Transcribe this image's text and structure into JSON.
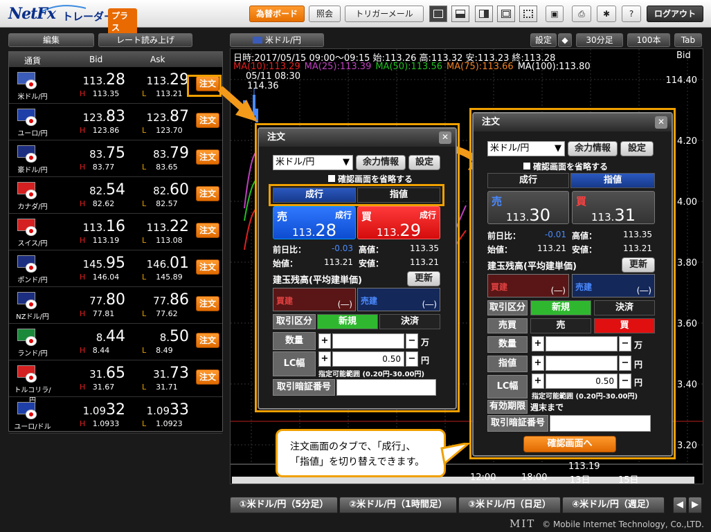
{
  "header": {
    "brand": "NetFx",
    "brand_sub": "トレーダー・",
    "plus": "プラス",
    "buttons": [
      "為替ボード",
      "照会",
      "トリガーメール"
    ],
    "logout": "ログアウト"
  },
  "left": {
    "edit": "編集",
    "readout": "レート読み上げ",
    "cols": {
      "cur": "通貨",
      "bid": "Bid",
      "ask": "Ask"
    },
    "order_label": "注文",
    "rates": [
      {
        "name": "米ドル/円",
        "bid_a": "113.",
        "bid_b": "28",
        "ask_a": "113.",
        "ask_b": "29",
        "high": "113.35",
        "low": "113.21",
        "order": true,
        "flag": "#3b5bb8"
      },
      {
        "name": "ユーロ/円",
        "bid_a": "123.",
        "bid_b": "83",
        "ask_a": "123.",
        "ask_b": "87",
        "high": "123.86",
        "low": "123.70",
        "order": true,
        "flag": "#1f3fa8"
      },
      {
        "name": "豪ドル/円",
        "bid_a": "83.",
        "bid_b": "75",
        "ask_a": "83.",
        "ask_b": "79",
        "high": "83.77",
        "low": "83.65",
        "order": true,
        "flag": "#1c2e80"
      },
      {
        "name": "カナダ/円",
        "bid_a": "82.",
        "bid_b": "54",
        "ask_a": "82.",
        "ask_b": "60",
        "high": "82.62",
        "low": "82.57",
        "order": true,
        "flag": "#d42020"
      },
      {
        "name": "スイス/円",
        "bid_a": "113.",
        "bid_b": "16",
        "ask_a": "113.",
        "ask_b": "22",
        "high": "113.19",
        "low": "113.08",
        "order": true,
        "flag": "#d42020"
      },
      {
        "name": "ポンド/円",
        "bid_a": "145.",
        "bid_b": "95",
        "ask_a": "146.",
        "ask_b": "01",
        "high": "146.04",
        "low": "145.89",
        "order": true,
        "flag": "#1c2e80"
      },
      {
        "name": "NZドル/円",
        "bid_a": "77.",
        "bid_b": "80",
        "ask_a": "77.",
        "ask_b": "86",
        "high": "77.81",
        "low": "77.62",
        "order": true,
        "flag": "#1c2e80"
      },
      {
        "name": "ランド/円",
        "bid_a": "8.",
        "bid_b": "44",
        "ask_a": "8.",
        "ask_b": "50",
        "high": "8.44",
        "low": "8.49",
        "order": true,
        "flag": "#1a8a3a"
      },
      {
        "name": "トルコリラ/円",
        "bid_a": "31.",
        "bid_b": "65",
        "ask_a": "31.",
        "ask_b": "73",
        "high": "31.67",
        "low": "31.71",
        "order": true,
        "flag": "#d42020"
      },
      {
        "name": "ユーロ/ドル",
        "bid_a": "1.09",
        "bid_b": "32",
        "ask_a": "1.09",
        "ask_b": "33",
        "high": "1.0933",
        "low": "1.0923",
        "order": false,
        "flag": "#1f3fa8"
      }
    ]
  },
  "chart": {
    "pair_tab": "米ドル/円",
    "settings": "設定",
    "period": "30分足",
    "count": "100本",
    "tab": "Tab",
    "ohlc": "日時:2017/05/15 09:00～09:15 始:113.26 高:113.32 安:113.23 終:113.28",
    "side": "Bid",
    "ma": [
      {
        "label": "MA(10):113.29",
        "color": "#e02020"
      },
      {
        "label": "MA(25):113.39",
        "color": "#c040c0"
      },
      {
        "label": "MA(50):113.56",
        "color": "#20c020"
      },
      {
        "label": "MA(75):113.66",
        "color": "#f08020"
      },
      {
        "label": "MA(100):113.80",
        "color": "#ffffff"
      }
    ],
    "peak_date": "05/11 08:30",
    "peak_val": "114.36",
    "y_ticks": [
      "114.40",
      "4.20",
      "4.00",
      "3.80",
      "3.60",
      "3.40",
      "3.20"
    ],
    "low_label": "113.19",
    "x_ticks": [
      "12:00",
      "18:00",
      "13日",
      "15日"
    ]
  },
  "bottom_tabs": [
    "①米ドル/円（5分足）",
    "②米ドル/円（1時間足）",
    "③米ドル/円（日足）",
    "④米ドル/円（週足）"
  ],
  "footer": "© Mobile Internet Technology, Co.,LTD.",
  "footer_logo": "MIT",
  "dialog_left": {
    "title": "注文",
    "pair": "米ドル/円",
    "margin_info": "余力情報",
    "settings": "設定",
    "skip_confirm": "確認画面を省略する",
    "tab_market": "成行",
    "tab_limit": "指値",
    "sell": "売",
    "buy": "買",
    "type": "成行",
    "sell_a": "113.",
    "sell_b": "28",
    "buy_a": "113.",
    "buy_b": "29",
    "prev": "前日比：",
    "prev_v": "-0.03",
    "high": "高値：",
    "high_v": "113.35",
    "open": "始値：",
    "open_v": "113.21",
    "low": "安値：",
    "low_v": "113.21",
    "position": "建玉残高(平均建単価)",
    "refresh": "更新",
    "pos_sell": "買建",
    "pos_buy": "売建",
    "dash": "(―)",
    "kind": "取引区分",
    "new": "新規",
    "settle": "決済",
    "qty": "数量",
    "unit_man": "万",
    "lc": "LC幅",
    "lc_v": "0.50",
    "unit_yen": "円",
    "range": "指定可能範囲 (0.20円-30.00円)",
    "pin": "取引暗証番号"
  },
  "dialog_right": {
    "title": "注文",
    "pair": "米ドル/円",
    "margin_info": "余力情報",
    "settings": "設定",
    "skip_confirm": "確認画面を省略する",
    "tab_market": "成行",
    "tab_limit": "指値",
    "sell": "売",
    "buy": "買",
    "sell_a": "113.",
    "sell_b": "30",
    "buy_a": "113.",
    "buy_b": "31",
    "prev": "前日比：",
    "prev_v": "-0.01",
    "high": "高値：",
    "high_v": "113.35",
    "open": "始値：",
    "open_v": "113.21",
    "low": "安値：",
    "low_v": "113.21",
    "position": "建玉残高(平均建単価)",
    "refresh": "更新",
    "pos_sell": "買建",
    "pos_buy": "売建",
    "dash": "(―)",
    "kind": "取引区分",
    "new": "新規",
    "settle": "決済",
    "side": "売買",
    "side_sell": "売",
    "side_buy": "買",
    "qty": "数量",
    "unit_man": "万",
    "limit": "指値",
    "unit_yen": "円",
    "lc": "LC幅",
    "lc_v": "0.50",
    "range": "指定可能範囲 (0.20円-30.00円)",
    "expiry": "有効期限",
    "expiry_v": "週末まで",
    "pin": "取引暗証番号",
    "confirm": "確認画面へ"
  },
  "callout": {
    "line1": "注文画面のタブで、「成行」、",
    "line2": "「指値」を切り替えできます。"
  }
}
